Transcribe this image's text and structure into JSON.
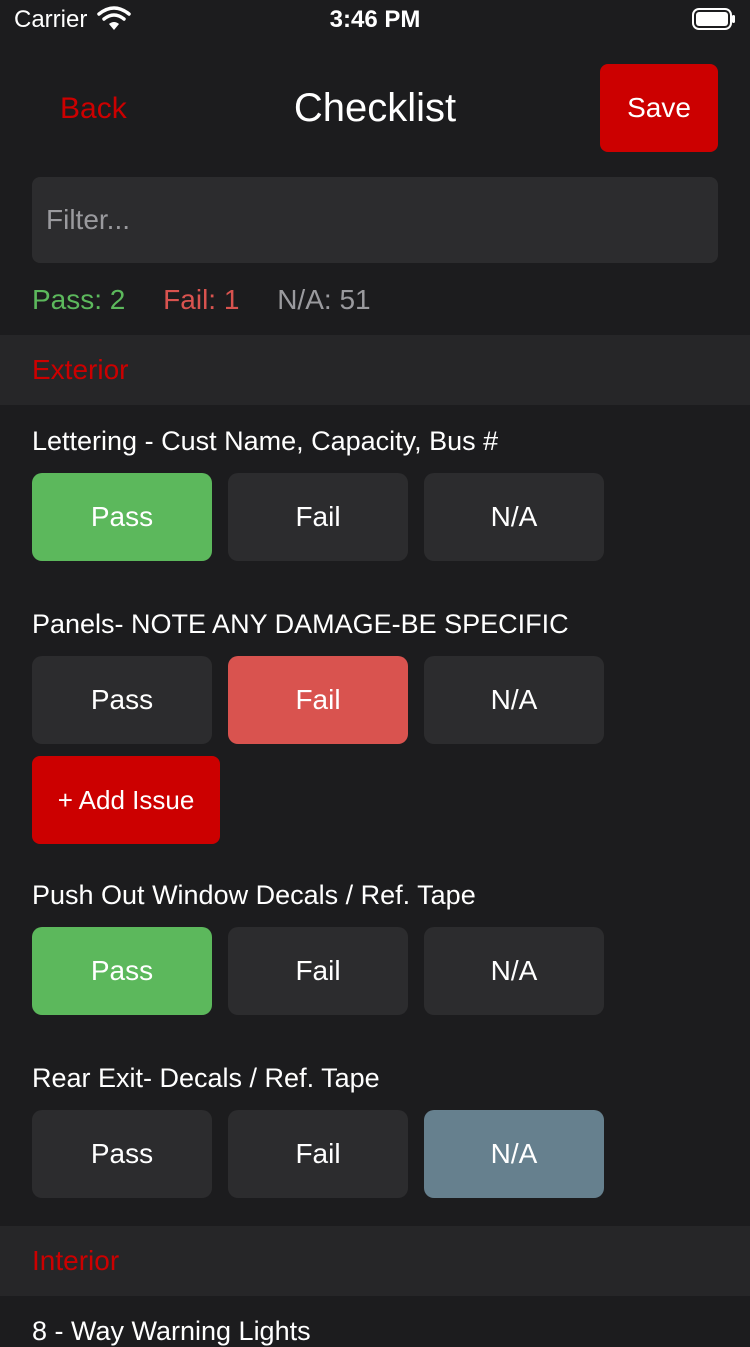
{
  "status_bar": {
    "carrier": "Carrier",
    "time": "3:46 PM"
  },
  "nav": {
    "back_label": "Back",
    "title": "Checklist",
    "save_label": "Save"
  },
  "filter": {
    "placeholder": "Filter..."
  },
  "counts": {
    "pass": "Pass: 2",
    "fail": "Fail: 1",
    "na": "N/A: 51"
  },
  "sections": [
    {
      "title": "Exterior",
      "items": [
        {
          "label": "Lettering - Cust Name, Capacity, Bus #",
          "selected": "pass"
        },
        {
          "label": "Panels- NOTE ANY DAMAGE-BE SPECIFIC",
          "selected": "fail",
          "add_issue_label": "+ Add Issue"
        },
        {
          "label": "Push Out Window Decals / Ref. Tape",
          "selected": "pass"
        },
        {
          "label": "Rear Exit- Decals / Ref. Tape",
          "selected": "na"
        }
      ]
    },
    {
      "title": "Interior",
      "items": [
        {
          "label": "8 - Way Warning Lights"
        }
      ]
    }
  ],
  "options": {
    "pass": "Pass",
    "fail": "Fail",
    "na": "N/A"
  },
  "colors": {
    "accent": "#cc0000",
    "pass": "#5cb85c",
    "fail": "#d9534f",
    "na": "#66808e",
    "background": "#1c1c1e"
  }
}
